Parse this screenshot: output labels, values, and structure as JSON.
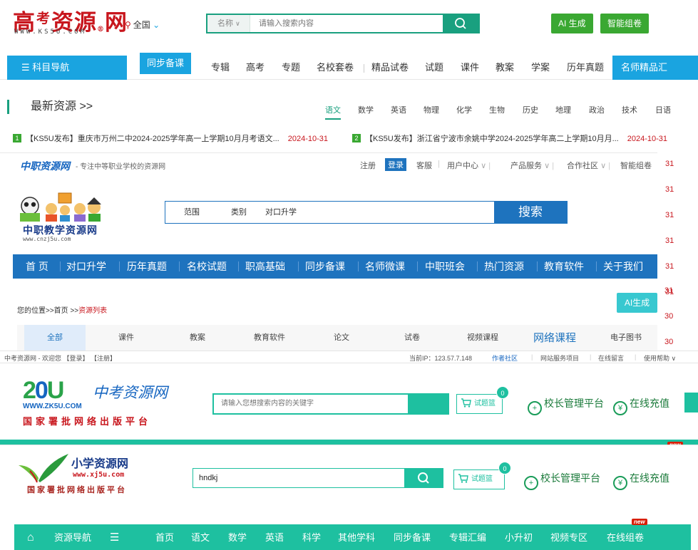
{
  "ks5u": {
    "logo_cn_1": "高",
    "logo_cn_2": "考",
    "logo_cn_3": "资源",
    "logo_reg": "®",
    "logo_cn_4": "网",
    "logo_en": "WWW.KS5U.COM",
    "region": "全国",
    "search": {
      "scope": "名称",
      "placeholder": "请输入搜索内容"
    },
    "ai_button": "AI 生成",
    "paper_button": "智能组卷",
    "nav_toggle": "科目导航",
    "nav": [
      "同步备课",
      "专辑",
      "高考",
      "专题",
      "名校套卷",
      "精品试卷",
      "试题",
      "课件",
      "教案",
      "学案",
      "历年真题"
    ],
    "nav_famous": "名师精品汇",
    "newest_title": "最新资源 >>",
    "subjects": [
      "语文",
      "数学",
      "英语",
      "物理",
      "化学",
      "生物",
      "历史",
      "地理",
      "政治",
      "技术",
      "日语"
    ],
    "news": [
      {
        "num": "1",
        "title": "【KS5U发布】重庆市万州二中2024-2025学年高一上学期10月月考语文...",
        "date": "2024-10-31"
      },
      {
        "num": "2",
        "title": "【KS5U发布】浙江省宁波市余姚中学2024-2025学年高二上学期10月月...",
        "date": "2024-10-31"
      }
    ],
    "side_dates": [
      "31",
      "31",
      "31",
      "31",
      "31",
      "31",
      "31"
    ]
  },
  "cnzj5u": {
    "brand": "中职资源网",
    "slogan": "- 专注中等职业学校的资源网",
    "top_links": {
      "register": "注册",
      "login": "登录",
      "service": "客服",
      "user_center": "用户中心",
      "products": "产品服务",
      "community": "合作社区",
      "smart_paper": "智能组卷"
    },
    "logo_text": "中职教学资源网",
    "logo_url": "www.cnzj5u.com",
    "search": {
      "label_scope": "范围",
      "label_category": "类别",
      "value": "对口升学",
      "button": "搜索"
    },
    "nav": [
      "首 页",
      "对口升学",
      "历年真题",
      "名校试题",
      "职高基础",
      "同步备课",
      "名师微课",
      "中职班会",
      "热门资源",
      "教育软件",
      "关于我们"
    ],
    "crumb": {
      "prefix": "您的位置>>首页 >>",
      "current": "资源列表"
    },
    "ai_button": "AI生成",
    "tabs": [
      "全部",
      "课件",
      "教案",
      "教育软件",
      "论文",
      "试卷",
      "视频课程",
      "网络课程",
      "电子图书"
    ],
    "side_values": [
      "31",
      "30",
      "30"
    ]
  },
  "zk5u": {
    "topbar_left": "中考资源网 - 欢迎您 【登录】 【注册】",
    "topbar_ip": "当前IP：123.57.7.148",
    "topbar_links": [
      "作者社区",
      "网站服务项目",
      "在线留言",
      "使用帮助 ∨"
    ],
    "logo_cn": "中考资源网",
    "logo_url": "WWW.ZK5U.COM",
    "logo_pub": "国家署批网络出版平台",
    "search_placeholder": "请输入您想搜索内容的关键字",
    "basket": "试题篮",
    "basket_count": "0",
    "principal": "校长管理平台",
    "recharge": "在线充值",
    "new_badge": "new"
  },
  "xj5u": {
    "logo_name": "小学资源网",
    "logo_url": "www.xj5u.com",
    "logo_pub": "国家署批网络出版平台",
    "search_value": "hndkj",
    "basket": "试题篮",
    "basket_count": "0",
    "principal": "校长管理平台",
    "recharge": "在线充值",
    "nav_home_label": "资源导航",
    "nav": [
      "首页",
      "语文",
      "数学",
      "英语",
      "科学",
      "其他学科",
      "同步备课",
      "专辑汇编",
      "小升初",
      "视频专区",
      "在线组卷"
    ],
    "new_badge": "new"
  },
  "colors": {
    "ks5u_red": "#c8161d",
    "ks5u_green": "#19a07f",
    "ks5u_blue": "#1aa4e0",
    "cnzj_blue": "#1e73be",
    "zk5u_teal": "#1ec0a0"
  }
}
